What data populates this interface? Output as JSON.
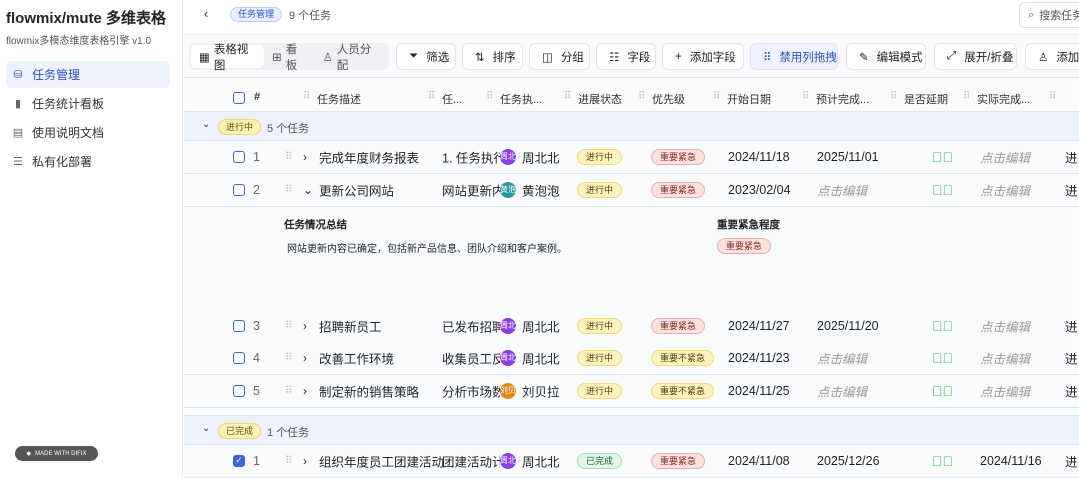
{
  "sidebar": {
    "title": "flowmix/mute 多维表格",
    "subtitle": "flowmix多模态维度表格引擎 v1.0",
    "items": [
      {
        "label": "任务管理",
        "icon": "database-icon"
      },
      {
        "label": "任务统计看板",
        "icon": "bar-chart-icon"
      },
      {
        "label": "使用说明文档",
        "icon": "document-icon"
      },
      {
        "label": "私有化部署",
        "icon": "server-icon"
      }
    ],
    "badge": "MADE WITH DIFIX"
  },
  "header": {
    "breadcrumb": "任务管理",
    "count": "9 个任务",
    "search_placeholder": "搜索任务"
  },
  "toolbar": {
    "views": [
      "表格视图",
      "看板",
      "人员分配"
    ],
    "buttons": [
      "筛选",
      "排序",
      "分组",
      "字段",
      "添加字段",
      "禁用列拖拽",
      "编辑模式",
      "展开/折叠",
      "添加"
    ]
  },
  "columns": [
    "#",
    "任务描述",
    "任...",
    "任务执...",
    "进展状态",
    "优先级",
    "开始日期",
    "预计完成...",
    "是否延期",
    "实际完成..."
  ],
  "groups": [
    {
      "label": "进行中",
      "count": "5 个任务"
    },
    {
      "label": "已完成",
      "count": "1 个任务"
    }
  ],
  "rows": [
    {
      "n": "1",
      "desc": "完成年度财务报表",
      "sub": "1. 任务执行",
      "av": "周北",
      "avc": "#8b3fe0",
      "owner": "周北北",
      "status": "进行中",
      "prio": "重要紧急",
      "pc": "red",
      "start": "2024/11/18",
      "due": "2025/11/01",
      "actual": "点击编辑",
      "last": "进",
      "exp": "›",
      "checked": false
    },
    {
      "n": "2",
      "desc": "更新公司网站",
      "sub": "网站更新内",
      "av": "黄泡",
      "avc": "#2b9aa0",
      "owner": "黄泡泡",
      "status": "进行中",
      "prio": "重要紧急",
      "pc": "red",
      "start": "2023/02/04",
      "due": "点击编辑",
      "actual": "点击编辑",
      "last": "进",
      "exp": "⌄",
      "checked": false
    },
    {
      "n": "3",
      "desc": "招聘新员工",
      "sub": "已发布招聘",
      "av": "周北",
      "avc": "#8b3fe0",
      "owner": "周北北",
      "status": "进行中",
      "prio": "重要紧急",
      "pc": "red",
      "start": "2024/11/27",
      "due": "2025/11/20",
      "actual": "点击编辑",
      "last": "进",
      "exp": "›",
      "checked": false
    },
    {
      "n": "4",
      "desc": "改善工作环境",
      "sub": "收集员工反",
      "av": "周北",
      "avc": "#8b3fe0",
      "owner": "周北北",
      "status": "进行中",
      "prio": "重要不紧急",
      "pc": "yellow",
      "start": "2024/11/23",
      "due": "点击编辑",
      "actual": "点击编辑",
      "last": "进",
      "exp": "›",
      "checked": false
    },
    {
      "n": "5",
      "desc": "制定新的销售策略",
      "sub": "分析市场数",
      "av": "刘贝",
      "avc": "#e8861c",
      "owner": "刘贝拉",
      "status": "进行中",
      "prio": "重要不紧急",
      "pc": "yellow",
      "start": "2024/11/25",
      "due": "点击编辑",
      "actual": "点击编辑",
      "last": "进",
      "exp": "›",
      "checked": false
    },
    {
      "n": "1",
      "desc": "组织年度员工团建活动",
      "sub": "团建活动计",
      "av": "周北",
      "avc": "#8b3fe0",
      "owner": "周北北",
      "status": "已完成",
      "prio": "重要紧急",
      "pc": "red",
      "start": "2024/11/08",
      "due": "2025/12/26",
      "actual": "2024/11/16",
      "last": "进",
      "exp": "›",
      "checked": true
    }
  ],
  "detail": {
    "summary_label": "任务情况总结",
    "summary": "网站更新内容已确定，包括新产品信息、团队介绍和客户案例。",
    "priority_label": "重要紧急程度",
    "priority": "重要紧急"
  }
}
